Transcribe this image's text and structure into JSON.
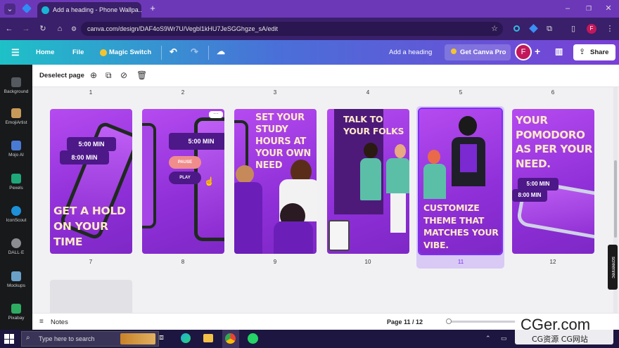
{
  "browser": {
    "tab_title": "Add a heading - Phone Wallpa...",
    "url": "canva.com/design/DAF4oS9Wr7U/Vegbl1kHU7JeSGGhgze_sA/edit",
    "profile_letter": "F"
  },
  "topbar": {
    "home": "Home",
    "file": "File",
    "magic_switch": "Magic Switch",
    "design_title": "Add a heading",
    "get_pro": "Get Canva Pro",
    "avatar_letter": "F",
    "share": "Share"
  },
  "sidebar": {
    "items": [
      {
        "label": "Background",
        "color": "#555a60"
      },
      {
        "label": "EmojiArtist",
        "color": "#c89a5a"
      },
      {
        "label": "Mojo AI",
        "color": "#4a7bd4"
      },
      {
        "label": "Pexels",
        "color": "#1fa77a"
      },
      {
        "label": "IconScout",
        "color": "#1e90d8"
      },
      {
        "label": "DALL·E",
        "color": "#8b8d92"
      },
      {
        "label": "Mockups",
        "color": "#6aa0c8"
      },
      {
        "label": "Pixabay",
        "color": "#2eac62"
      }
    ]
  },
  "toolbar": {
    "deselect": "Deselect page"
  },
  "pages_top_numbers": [
    "1",
    "2",
    "3",
    "4",
    "5",
    "6"
  ],
  "pages": [
    {
      "number": "7",
      "text": "GET A HOLD ON YOUR TIME",
      "pills": [
        "5:00 MIN",
        "8:00 MIN"
      ]
    },
    {
      "number": "8",
      "pills": [
        "5:00 MIN",
        "PAUSE",
        "PLAY"
      ]
    },
    {
      "number": "9",
      "text": "SET YOUR STUDY HOURS AT YOUR OWN NEED"
    },
    {
      "number": "10",
      "text": "TALK TO YOUR FOLKS"
    },
    {
      "number": "11",
      "text": "CUSTOMIZE THEME THAT MATCHES YOUR VIBE."
    },
    {
      "number": "12",
      "text": "YOUR POMODORO AS PER YOUR NEED.",
      "pills": [
        "5:00 MIN",
        "8:00 MIN"
      ]
    }
  ],
  "bottom": {
    "notes": "Notes",
    "page_indicator": "Page 11 / 12"
  },
  "taskbar": {
    "search_placeholder": "Type here to search"
  },
  "watermark": {
    "brand": "CGer.com",
    "sub": "CG资源 CG网站"
  },
  "side_badge": "screenrec",
  "colors": {
    "accent": "#7b2ff7",
    "selected_page_bg": "#d9c9f5",
    "page_purple": "#9b3be0"
  }
}
